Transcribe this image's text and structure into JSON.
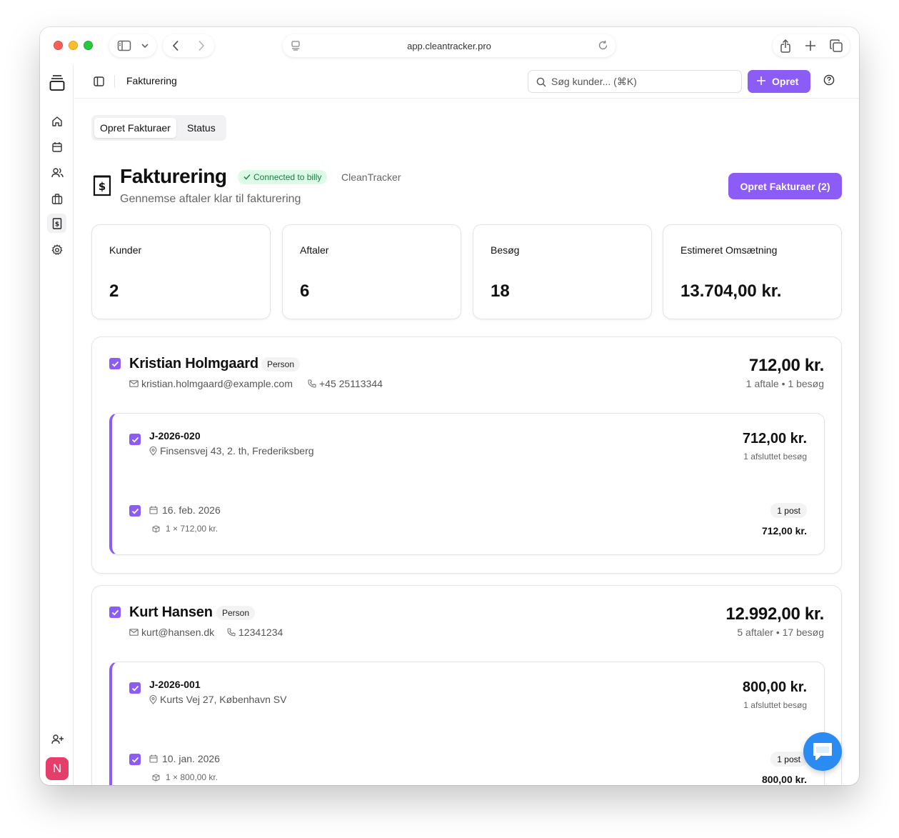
{
  "browser": {
    "url": "app.cleantracker.pro"
  },
  "topbar": {
    "breadcrumb": "Fakturering",
    "search_placeholder": "Søg kunder... (⌘K)",
    "create_label": "Opret"
  },
  "sidebar": {
    "icons": [
      "layers-icon",
      "home-icon",
      "calendar-icon",
      "users-icon",
      "briefcase-icon",
      "invoice-icon",
      "settings-icon"
    ],
    "avatar_initial": "N"
  },
  "tabs": [
    "Opret Fakturaer",
    "Status"
  ],
  "header": {
    "title": "Fakturering",
    "badge": "Connected to billy",
    "org": "CleanTracker",
    "subtitle": "Gennemse aftaler klar til fakturering",
    "create_button": "Opret Fakturaer (2)"
  },
  "stats": [
    {
      "label": "Kunder",
      "value": "2"
    },
    {
      "label": "Aftaler",
      "value": "6"
    },
    {
      "label": "Besøg",
      "value": "18"
    },
    {
      "label": "Estimeret Omsætning",
      "value": "13.704,00 kr."
    }
  ],
  "customers": [
    {
      "name": "Kristian Holmgaard",
      "type": "Person",
      "email": "kristian.holmgaard@example.com",
      "phone": "+45 25113344",
      "total": "712,00 kr.",
      "summary": "1 aftale • 1 besøg",
      "agreement": {
        "number": "J-2026-020",
        "address": "Finsensvej 43, 2. th, Frederiksberg",
        "total": "712,00 kr.",
        "visits_summary": "1 afsluttet besøg",
        "visit_date": "16. feb. 2026",
        "visit_line": "1 × 712,00 kr.",
        "visit_posts": "1 post",
        "visit_amount": "712,00 kr."
      }
    },
    {
      "name": "Kurt Hansen",
      "type": "Person",
      "email": "kurt@hansen.dk",
      "phone": "12341234",
      "total": "12.992,00 kr.",
      "summary": "5 aftaler • 17 besøg",
      "agreement": {
        "number": "J-2026-001",
        "address": "Kurts Vej 27, København SV",
        "total": "800,00 kr.",
        "visits_summary": "1 afsluttet besøg",
        "visit_date": "10. jan. 2026",
        "visit_line": "1 × 800,00 kr.",
        "visit_posts": "1 post",
        "visit_amount": "800,00 kr."
      }
    }
  ]
}
